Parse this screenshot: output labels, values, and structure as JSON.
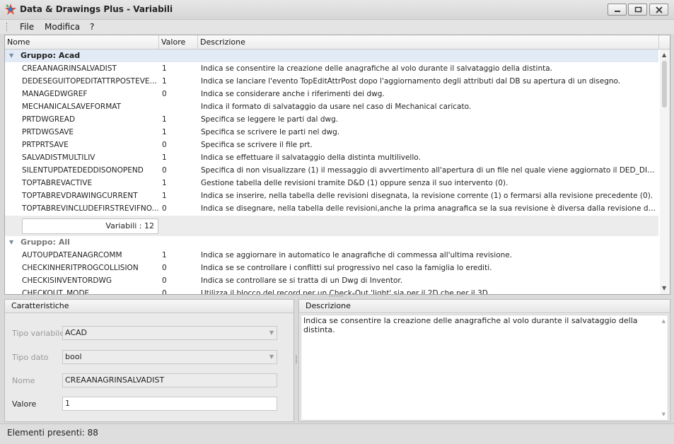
{
  "window": {
    "title": "Data & Drawings Plus - Variabili"
  },
  "menu": {
    "file": "File",
    "modifica": "Modifica",
    "help": "?"
  },
  "grid": {
    "columns": {
      "nome": "Nome",
      "valore": "Valore",
      "descrizione": "Descrizione"
    },
    "group_acad": {
      "label": "Gruppo: Acad",
      "rows": [
        {
          "nome": "CREAANAGRINSALVADIST",
          "valore": "1",
          "desc": "Indica se consentire la creazione delle anagrafiche al volo durante il salvataggio della distinta."
        },
        {
          "nome": "DEDESEGUITOPEDITATTRPOSTEVENT",
          "valore": "1",
          "desc": "Indica se lanciare l'evento TopEditAttrPost dopo l'aggiornamento degli attributi dal DB su apertura di un disegno."
        },
        {
          "nome": "MANAGEDWGREF",
          "valore": "0",
          "desc": "Indica se considerare anche i riferimenti dei dwg."
        },
        {
          "nome": "MECHANICALSAVEFORMAT",
          "valore": "",
          "desc": "Indica il formato di salvataggio da usare nel caso di Mechanical caricato."
        },
        {
          "nome": "PRTDWGREAD",
          "valore": "1",
          "desc": "Specifica se leggere le parti dal dwg."
        },
        {
          "nome": "PRTDWGSAVE",
          "valore": "1",
          "desc": "Specifica se scrivere le parti nel dwg."
        },
        {
          "nome": "PRTPRTSAVE",
          "valore": "0",
          "desc": "Specifica se scrivere il file prt."
        },
        {
          "nome": "SALVADISTMULTILIV",
          "valore": "1",
          "desc": "Indica se effettuare il salvataggio della distinta multilivello."
        },
        {
          "nome": "SILENTUPDATEDEDDISONOPEND",
          "valore": "0",
          "desc": "Specifica di non visualizzare (1) il messaggio di avvertimento all'apertura di un file nel quale viene aggiornato il DED_DIS perché inco..."
        },
        {
          "nome": "TOPTABREVACTIVE",
          "valore": "1",
          "desc": "Gestione tabella delle revisioni tramite D&D (1) oppure senza il suo intervento (0)."
        },
        {
          "nome": "TOPTABREVDRAWINGCURRENT",
          "valore": "1",
          "desc": "Indica se inserire, nella tabella delle revisioni disegnata, la revisione corrente (1) o fermarsi alla revisione precedente (0)."
        },
        {
          "nome": "TOPTABREVINCLUDEFIRSTREVIFNO...",
          "valore": "0",
          "desc": "Indica se disegnare, nella tabella delle revisioni,anche la prima anagrafica se la sua revisione è diversa dalla revisione di default."
        }
      ],
      "footer": "Variabili : 12"
    },
    "group_all": {
      "label": "Gruppo: All",
      "rows": [
        {
          "nome": "AUTOUPDATEANAGRCOMM",
          "valore": "1",
          "desc": "Indica se aggiornare in automatico le anagrafiche di commessa all'ultima revisione."
        },
        {
          "nome": "CHECKINHERITPROGCOLLISION",
          "valore": "0",
          "desc": "Indica se se controllare i conflitti sul progressivo nel caso la famiglia lo erediti."
        },
        {
          "nome": "CHECKISINVENTORDWG",
          "valore": "0",
          "desc": "Indica se controllare se si tratta di un Dwg di Inventor."
        },
        {
          "nome": "CHECKOUT_MODE",
          "valore": "0",
          "desc": "Utilizza il blocco del record per un Check-Out 'light' sia per il 2D che per il 3D."
        }
      ]
    }
  },
  "caratteristiche": {
    "title": "Caratteristiche",
    "tipo_variabile_label": "Tipo variabile",
    "tipo_variabile_value": "ACAD",
    "tipo_dato_label": "Tipo dato",
    "tipo_dato_value": "bool",
    "nome_label": "Nome",
    "nome_value": "CREAANAGRINSALVADIST",
    "valore_label": "Valore",
    "valore_value": "1"
  },
  "descrizione": {
    "title": "Descrizione",
    "text": "Indica se consentire la creazione delle anagrafiche al volo durante il salvataggio della distinta."
  },
  "status": {
    "text": "Elementi presenti: 88"
  }
}
